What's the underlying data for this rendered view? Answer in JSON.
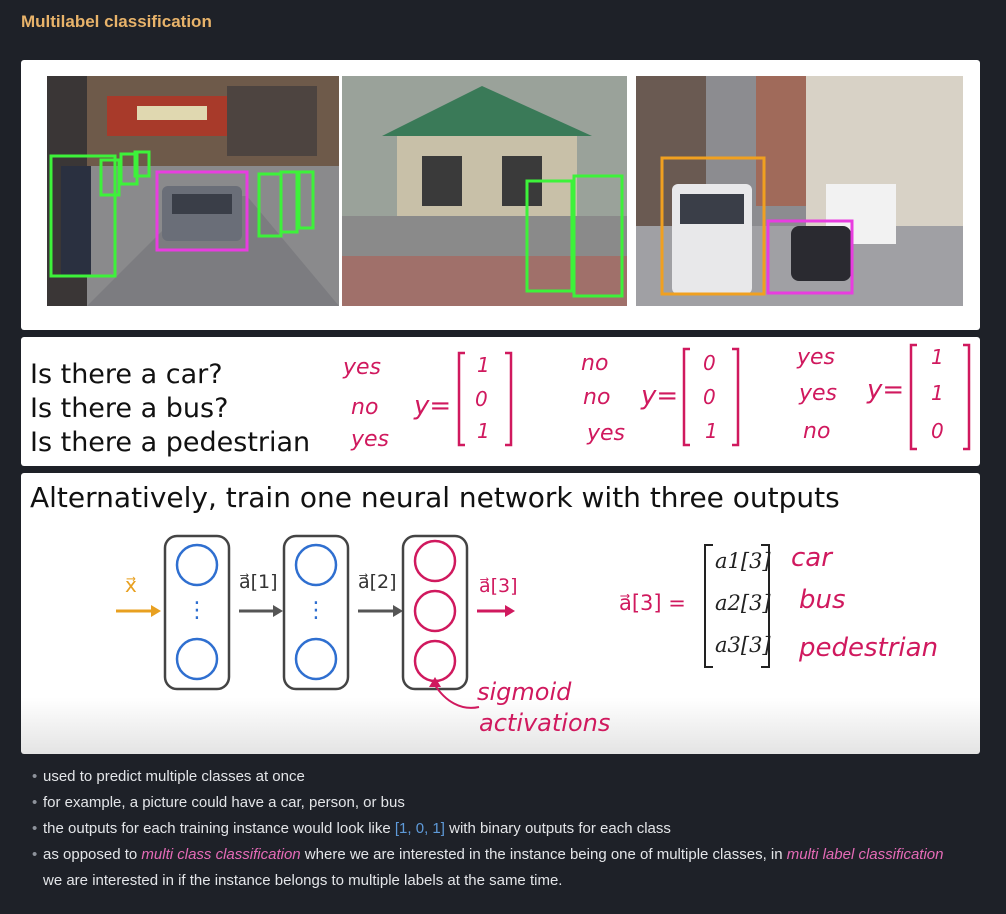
{
  "page": {
    "title": "Multilabel classification"
  },
  "questions": {
    "lines": [
      "Is there a car?",
      "Is there a bus?",
      "Is there a pedestrian"
    ],
    "columns": [
      {
        "answers": [
          "yes",
          "no",
          "yes"
        ],
        "y_label": "y=",
        "vector": [
          "1",
          "0",
          "1"
        ]
      },
      {
        "answers": [
          "no",
          "no",
          "yes"
        ],
        "y_label": "y=",
        "vector": [
          "0",
          "0",
          "1"
        ]
      },
      {
        "answers": [
          "yes",
          "yes",
          "no"
        ],
        "y_label": "y=",
        "vector": [
          "1",
          "1",
          "0"
        ]
      }
    ]
  },
  "network": {
    "title": "Alternatively, train one neural network with three outputs",
    "input_label": "x⃗",
    "a1": "a⃗[1]",
    "a2": "a⃗[2]",
    "a3": "a⃗[3]",
    "vector_lhs": "a⃗[3] =",
    "vector_entries": [
      "a1[3]",
      "a2[3]",
      "a3[3]"
    ],
    "labels": [
      "car",
      "bus",
      "pedestrian"
    ],
    "annotation": [
      "sigmoid",
      "activations"
    ],
    "colors": {
      "input": "#e8a020",
      "node_blue": "#2f6fd0",
      "output": "#d0195e",
      "box": "#444444"
    }
  },
  "bullets": {
    "b1": "used to predict multiple classes at once",
    "b2": "for example, a picture could have a car, person, or bus",
    "b3_pre": "the outputs for each training instance would look like ",
    "b3_code": "[1, 0, 1]",
    "b3_post": " with binary outputs for each class",
    "b4_pre": "as opposed to ",
    "b4_em1": "multi class classification",
    "b4_mid": " where we are interested in the instance being one of multiple classes, in ",
    "b4_em2": "multi label classification",
    "b4_post": " we are interested in if the instance belongs to multiple labels at the same time."
  }
}
